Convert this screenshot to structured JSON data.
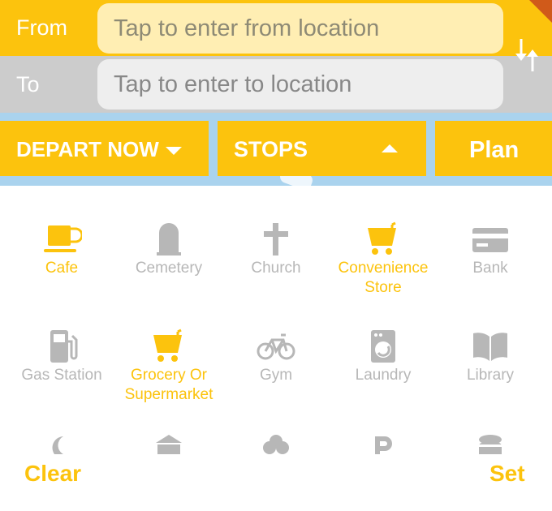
{
  "from": {
    "label": "From",
    "placeholder": "Tap to enter from location"
  },
  "to": {
    "label": "To",
    "placeholder": "Tap to enter to location"
  },
  "buttons": {
    "depart": "DEPART NOW",
    "stops": "STOPS",
    "plan": "Plan"
  },
  "categories": [
    {
      "label": "Cafe",
      "icon": "coffee-cup-icon",
      "active": true
    },
    {
      "label": "Cemetery",
      "icon": "tombstone-icon",
      "active": false
    },
    {
      "label": "Church",
      "icon": "cross-icon",
      "active": false
    },
    {
      "label": "Convenience Store",
      "icon": "shopping-cart-icon",
      "active": true
    },
    {
      "label": "Bank",
      "icon": "credit-card-icon",
      "active": false
    },
    {
      "label": "Gas Station",
      "icon": "fuel-pump-icon",
      "active": false
    },
    {
      "label": "Grocery Or Supermarket",
      "icon": "shopping-cart-icon",
      "active": true
    },
    {
      "label": "Gym",
      "icon": "bicycle-icon",
      "active": false
    },
    {
      "label": "Laundry",
      "icon": "washing-machine-icon",
      "active": false
    },
    {
      "label": "Library",
      "icon": "book-icon",
      "active": false
    }
  ],
  "footer": {
    "clear": "Clear",
    "set": "Set"
  },
  "colors": {
    "accent": "#fcc30d",
    "inactive": "#b7b7b7",
    "from_bg": "#ffeeb3",
    "to_bg": "#cccccc"
  }
}
